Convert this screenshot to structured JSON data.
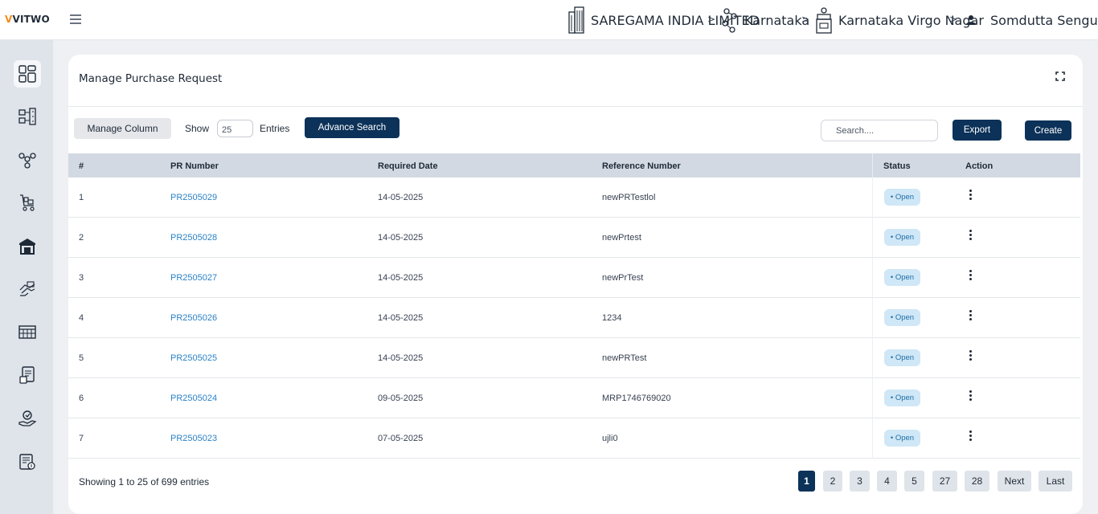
{
  "header": {
    "logo_prefix": "V",
    "logo_text": "VITWO",
    "breadcrumbs": [
      {
        "label": "SAREGAMA INDIA LIMITED",
        "icon": "building-icon"
      },
      {
        "label": "Karnataka",
        "icon": "network-nodes-icon"
      },
      {
        "label": "Karnataka Virgo Nagar",
        "icon": "store-icon"
      },
      {
        "label": "Somdutta Sengupta",
        "icon": "user-icon"
      }
    ],
    "separator": ">"
  },
  "sidebar": {
    "items": [
      {
        "name": "dashboard-icon",
        "active": true
      },
      {
        "name": "data-flow-icon",
        "active": false
      },
      {
        "name": "hierarchy-icon",
        "active": false
      },
      {
        "name": "cart-icon",
        "active": false
      },
      {
        "name": "warehouse-icon",
        "active": false
      },
      {
        "name": "handshake-icon",
        "active": false
      },
      {
        "name": "building-grid-icon",
        "active": false
      },
      {
        "name": "invoice-icon",
        "active": false
      },
      {
        "name": "service-hand-icon",
        "active": false
      },
      {
        "name": "report-icon",
        "active": false
      }
    ]
  },
  "page": {
    "title": "Manage Purchase Request",
    "manage_column_label": "Manage Column",
    "show_label": "Show",
    "entries_value": "25",
    "entries_label": "Entries",
    "advance_search_label": "Advance Search",
    "search_placeholder": "Search....",
    "export_label": "Export",
    "create_label": "Create"
  },
  "table": {
    "columns": [
      "#",
      "PR Number",
      "Required Date",
      "Reference Number",
      "Status",
      "Action"
    ],
    "rows": [
      {
        "index": "1",
        "pr_number": "PR2505029",
        "required_date": "14-05-2025",
        "reference": "newPRTestlol",
        "status": "• Open"
      },
      {
        "index": "2",
        "pr_number": "PR2505028",
        "required_date": "14-05-2025",
        "reference": "newPrtest",
        "status": "• Open"
      },
      {
        "index": "3",
        "pr_number": "PR2505027",
        "required_date": "14-05-2025",
        "reference": "newPrTest",
        "status": "• Open"
      },
      {
        "index": "4",
        "pr_number": "PR2505026",
        "required_date": "14-05-2025",
        "reference": "1234",
        "status": "• Open"
      },
      {
        "index": "5",
        "pr_number": "PR2505025",
        "required_date": "14-05-2025",
        "reference": "newPRTest",
        "status": "• Open"
      },
      {
        "index": "6",
        "pr_number": "PR2505024",
        "required_date": "09-05-2025",
        "reference": "MRP1746769020",
        "status": "• Open"
      },
      {
        "index": "7",
        "pr_number": "PR2505023",
        "required_date": "07-05-2025",
        "reference": "ujli0",
        "status": "• Open"
      }
    ]
  },
  "footer": {
    "showing_text": "Showing 1 to 25 of 699 entries",
    "pages": [
      "1",
      "2",
      "3",
      "4",
      "5",
      "27",
      "28"
    ],
    "active_page": "1",
    "next_label": "Next",
    "last_label": "Last"
  },
  "colors": {
    "primary": "#0c3259",
    "link": "#2b82c6",
    "status_badge_bg": "#cfe7f6",
    "status_badge_text": "#1f6fa8",
    "table_header_bg": "#d2d9e2",
    "sidebar_bg": "#dfe3ea",
    "logo_accent": "#f28c1a"
  }
}
